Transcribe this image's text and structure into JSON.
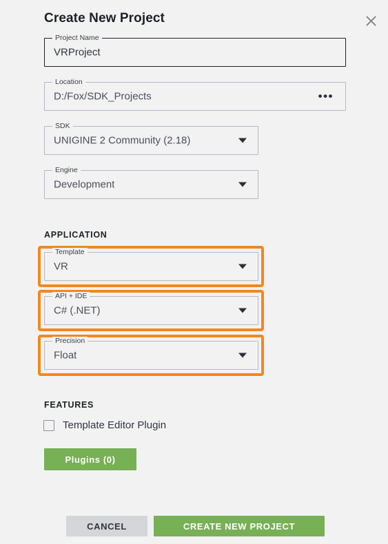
{
  "dialog": {
    "title": "Create New Project",
    "close_icon": "close-icon"
  },
  "fields": {
    "project_name": {
      "label": "Project Name",
      "value": "VRProject",
      "placeholder": "Project Name"
    },
    "location": {
      "label": "Location",
      "value": "D:/Fox/SDK_Projects",
      "placeholder": "Location",
      "browse_glyph": "•••"
    },
    "sdk": {
      "label": "SDK",
      "value": "UNIGINE 2 Community (2.18)"
    },
    "engine": {
      "label": "Engine",
      "value": "Development"
    },
    "template": {
      "label": "Template",
      "value": "VR"
    },
    "api_ide": {
      "label": "API + IDE",
      "value": "C# (.NET)"
    },
    "precision": {
      "label": "Precision",
      "value": "Float"
    }
  },
  "sections": {
    "application": "APPLICATION",
    "features": "FEATURES"
  },
  "features": {
    "template_editor_plugin": {
      "label": "Template Editor Plugin",
      "checked": false
    },
    "plugins_button": "Plugins (0)"
  },
  "actions": {
    "cancel": "CANCEL",
    "create": "CREATE NEW PROJECT"
  },
  "colors": {
    "highlight": "#f3881a",
    "accent_green": "#77b055",
    "cancel_gray": "#d4d6da",
    "background": "#f2f2f3"
  }
}
